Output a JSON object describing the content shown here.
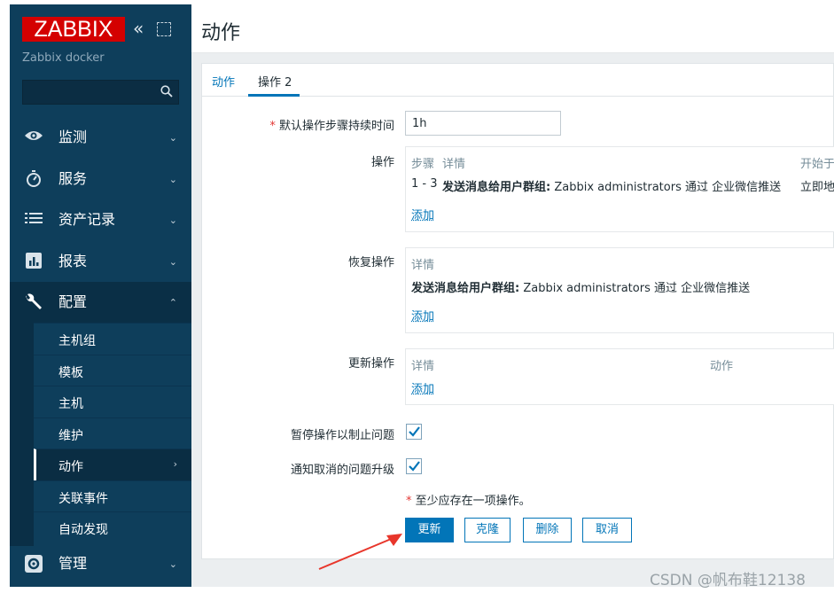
{
  "sidebar": {
    "logo": "ZABBIX",
    "collapse_symbol": "«",
    "server_name": "Zabbix docker",
    "search_value": "",
    "menu": [
      {
        "label": "监测",
        "icon": "eye-icon",
        "chevron": "⌄"
      },
      {
        "label": "服务",
        "icon": "stopwatch-icon",
        "chevron": "⌄"
      },
      {
        "label": "资产记录",
        "icon": "list-icon",
        "chevron": "⌄"
      },
      {
        "label": "报表",
        "icon": "bar-chart-icon",
        "chevron": "⌄"
      },
      {
        "label": "配置",
        "icon": "wrench-icon",
        "chevron": "⌃"
      },
      {
        "label": "管理",
        "icon": "gear-icon",
        "chevron": "⌄"
      }
    ],
    "submenu": [
      {
        "label": "主机组"
      },
      {
        "label": "模板"
      },
      {
        "label": "主机"
      },
      {
        "label": "维护"
      },
      {
        "label": "动作",
        "chevron": "›",
        "active": true
      },
      {
        "label": "关联事件"
      },
      {
        "label": "自动发现"
      }
    ]
  },
  "page": {
    "title": "动作",
    "tabs": [
      {
        "label": "动作"
      },
      {
        "label": "操作 2"
      }
    ]
  },
  "form": {
    "required_mark": "*",
    "default_duration_label": "默认操作步骤持续时间",
    "default_duration_value": "1h",
    "operations": {
      "label": "操作",
      "headers": [
        "步骤",
        "详情",
        "开始于"
      ],
      "row": {
        "steps": "1 - 3",
        "details_bold": "发送消息给用户群组:",
        "details_rest": " Zabbix administrators 通过 企业微信推送",
        "start": "立即地"
      },
      "add": "添加"
    },
    "recovery": {
      "label": "恢复操作",
      "headers": [
        "详情"
      ],
      "row": {
        "details_bold": "发送消息给用户群组:",
        "details_rest": " Zabbix administrators 通过 企业微信推送"
      },
      "add": "添加"
    },
    "update": {
      "label": "更新操作",
      "headers": [
        "详情",
        "动作"
      ],
      "add": "添加"
    },
    "pause_label": "暂停操作以制止问题",
    "pause_checked": true,
    "notify_label": "通知取消的问题升级",
    "notify_checked": true,
    "note": "至少应存在一项操作。"
  },
  "buttons": {
    "update": "更新",
    "clone": "克隆",
    "delete": "删除",
    "cancel": "取消"
  },
  "colors": {
    "sidebar": "#0e3e5b",
    "logo": "#d40000",
    "accent": "#0275b8",
    "arrow": "#e8362b"
  },
  "watermark": "CSDN @帆布鞋12138"
}
